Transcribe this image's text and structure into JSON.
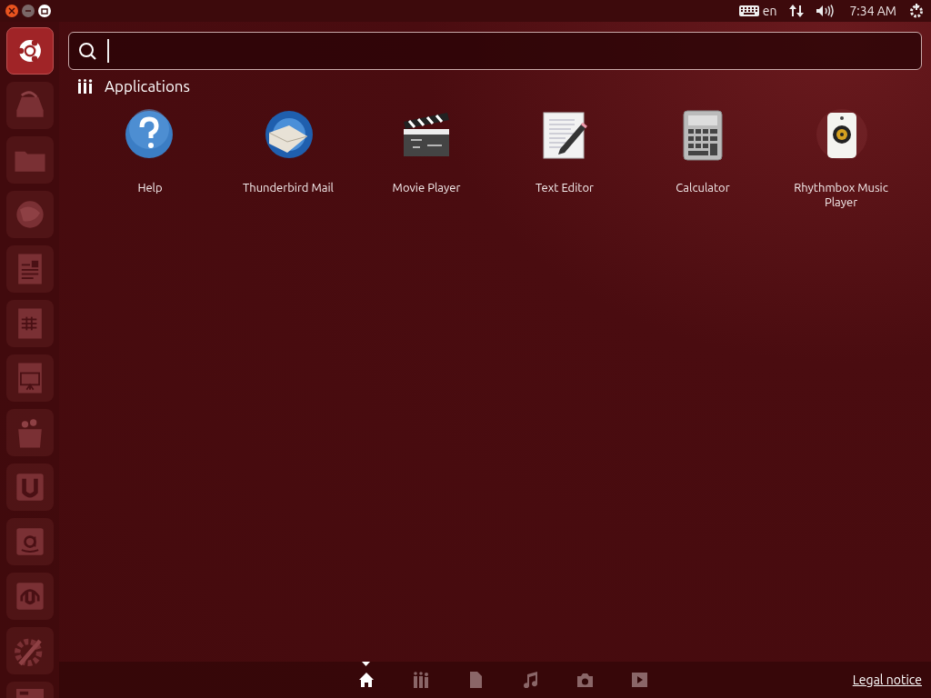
{
  "top_bar": {
    "keyboard_layout": "en",
    "clock": "7:34 AM"
  },
  "section": {
    "title": "Applications"
  },
  "apps": [
    {
      "kind": "help",
      "label": "Help"
    },
    {
      "kind": "mail",
      "label": "Thunderbird Mail"
    },
    {
      "kind": "video",
      "label": "Movie Player"
    },
    {
      "kind": "editor",
      "label": "Text Editor"
    },
    {
      "kind": "calculator",
      "label": "Calculator"
    },
    {
      "kind": "music",
      "label": "Rhythmbox Music Player"
    }
  ],
  "lenses": [
    {
      "kind": "home",
      "selected": true
    },
    {
      "kind": "applications",
      "selected": false
    },
    {
      "kind": "files",
      "selected": false
    },
    {
      "kind": "music",
      "selected": false
    },
    {
      "kind": "photos",
      "selected": false
    },
    {
      "kind": "video",
      "selected": false
    }
  ],
  "legal_link": "Legal notice"
}
